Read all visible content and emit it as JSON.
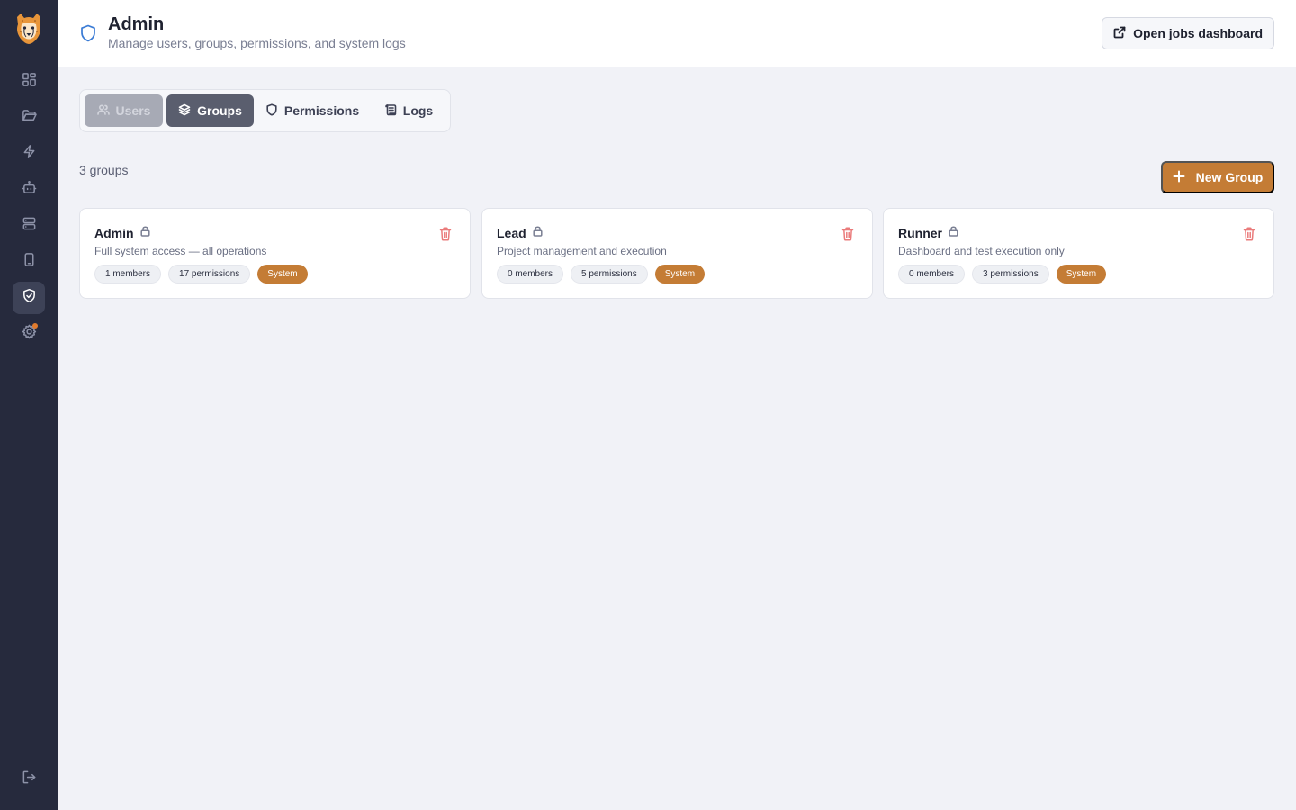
{
  "sidebar": {
    "logo": "cheetah-logo",
    "items": [
      {
        "name": "dashboard",
        "icon": "grid-icon",
        "active": false
      },
      {
        "name": "projects",
        "icon": "folder-icon",
        "active": false
      },
      {
        "name": "jobs",
        "icon": "lightning-icon",
        "active": false
      },
      {
        "name": "agents",
        "icon": "robot-icon",
        "active": false
      },
      {
        "name": "servers",
        "icon": "server-icon",
        "active": false
      },
      {
        "name": "devices",
        "icon": "mobile-icon",
        "active": false
      },
      {
        "name": "admin",
        "icon": "shield-check-icon",
        "active": true
      },
      {
        "name": "settings",
        "icon": "gear-icon",
        "active": false,
        "notification": true
      }
    ],
    "logout_icon": "logout-icon"
  },
  "header": {
    "icon": "shield-icon",
    "title": "Admin",
    "subtitle": "Manage users, groups, permissions, and system logs",
    "open_dashboard_label": "Open jobs dashboard"
  },
  "tabs": [
    {
      "label": "Users",
      "icon": "users-icon",
      "state": "disabled"
    },
    {
      "label": "Groups",
      "icon": "layers-icon",
      "state": "selected"
    },
    {
      "label": "Permissions",
      "icon": "shield-icon",
      "state": "normal"
    },
    {
      "label": "Logs",
      "icon": "scroll-icon",
      "state": "normal"
    }
  ],
  "groups_summary": "3 groups",
  "new_group_label": "New Group",
  "groups": [
    {
      "name": "Admin",
      "description": "Full system access — all operations",
      "members": "1 members",
      "permissions": "17 permissions",
      "tag": "System"
    },
    {
      "name": "Lead",
      "description": "Project management and execution",
      "members": "0 members",
      "permissions": "5 permissions",
      "tag": "System"
    },
    {
      "name": "Runner",
      "description": "Dashboard and test execution only",
      "members": "0 members",
      "permissions": "3 permissions",
      "tag": "System"
    }
  ],
  "colors": {
    "sidebar_bg": "#262a3d",
    "accent": "#c47c35",
    "danger": "#ea7b7b",
    "header_icon": "#3a7bd5"
  }
}
